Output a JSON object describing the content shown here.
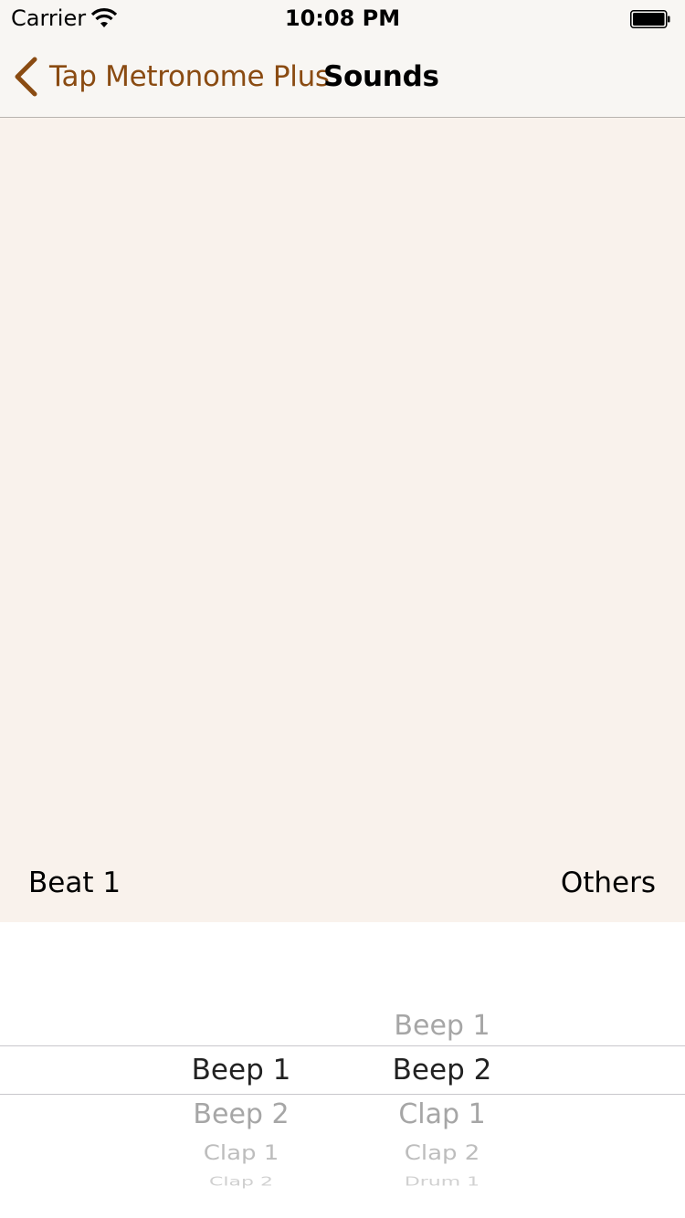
{
  "status_bar": {
    "carrier": "Carrier",
    "time": "10:08 PM"
  },
  "nav": {
    "back_label": "Tap Metronome Plus",
    "title": "Sounds",
    "accent_color": "#8a4b12"
  },
  "content": {
    "background_color": "#f9f2ec",
    "left_label": "Beat 1",
    "right_label": "Others"
  },
  "picker": {
    "beat1_column": {
      "selected": "Beep 1",
      "below": [
        "Beep 2",
        "Clap 1",
        "Clap 2"
      ]
    },
    "others_column": {
      "above": "Beep 1",
      "selected": "Beep 2",
      "below": [
        "Clap 1",
        "Clap 2",
        "Drum 1"
      ]
    }
  }
}
